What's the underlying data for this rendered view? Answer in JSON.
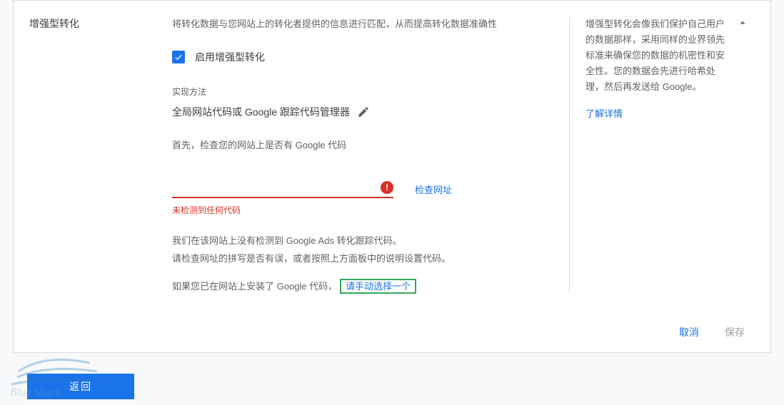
{
  "section": {
    "title": "增强型转化"
  },
  "middle": {
    "desc": "将转化数据与您网站上的转化者提供的信息进行匹配，从而提高转化数据准确性",
    "checkbox_label": "启用增强型转化",
    "method_label": "实现方法",
    "method_value": "全局网站代码或 Google 跟踪代码管理器",
    "first_text": "首先，检查您的网站上是否有 Google 代码",
    "check_url": "检查网址",
    "error_text": "未检测到任何代码",
    "result_l1": "我们在该网站上没有检测到 Google Ads 转化跟踪代码。",
    "result_l2": "请检查网址的拼写是否有误，或者按照上方面板中的说明设置代码。",
    "installed_prefix": "如果您已在网站上安装了 Google 代码，",
    "manual_link": "请手动选择一个"
  },
  "right": {
    "text": "增强型转化会像我们保护自己用户的数据那样，采用同样的业界领先标准来确保您的数据的机密性和安全性。您的数据会先进行哈希处理，然后再发送给 Google。",
    "learn_link": "了解详情"
  },
  "actions": {
    "cancel": "取消",
    "save": "保存",
    "back": "返回"
  },
  "watermark": {
    "text": "Blue Shark"
  }
}
